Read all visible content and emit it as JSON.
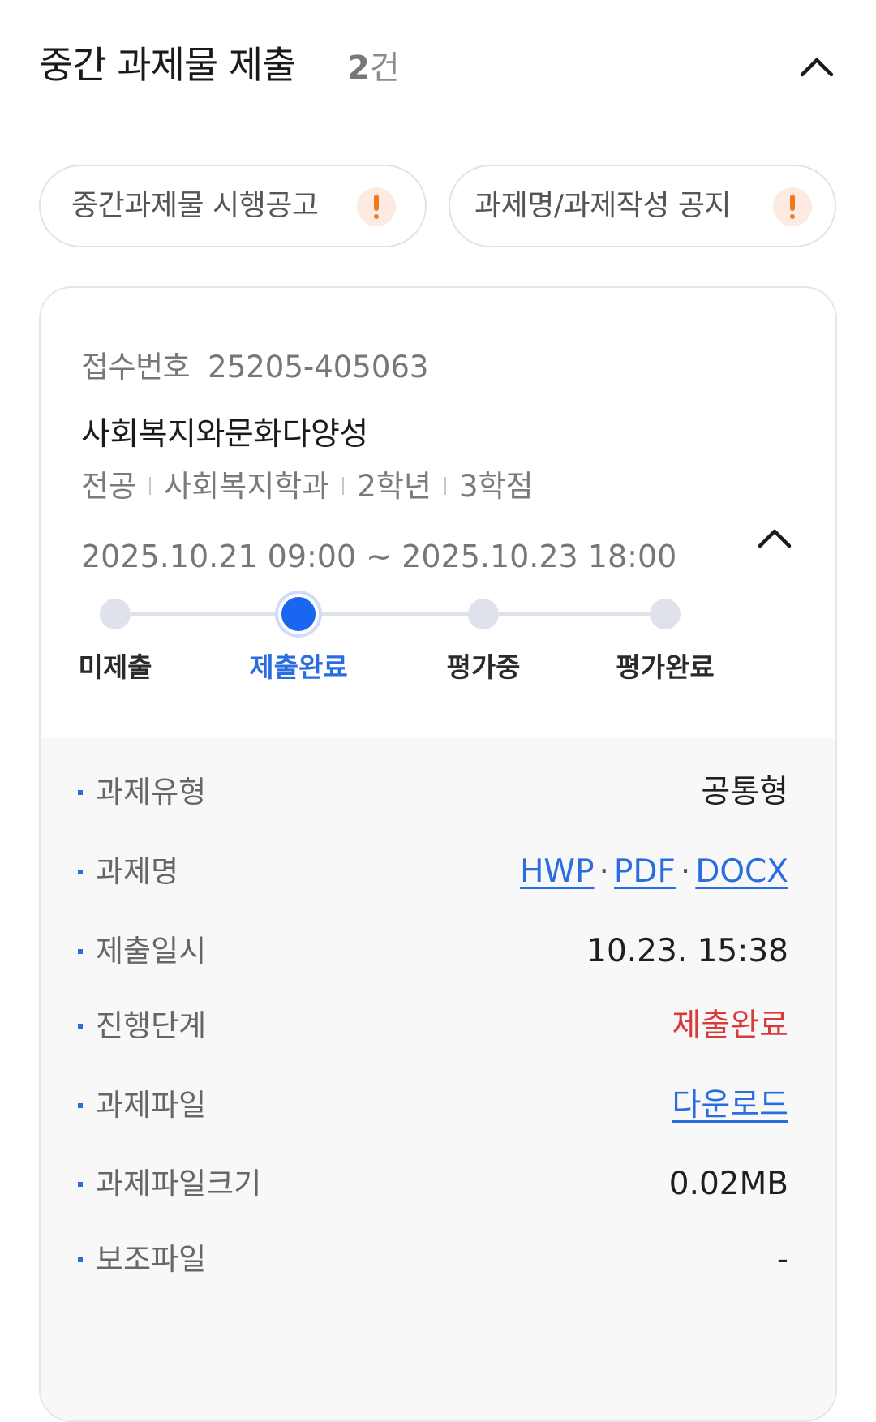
{
  "header": {
    "title": "중간 과제물 제출",
    "count_num": "2",
    "count_unit": "건",
    "collapse_icon": "chevron-up-icon"
  },
  "notices": [
    {
      "label": "중간과제물 시행공고",
      "icon": "alert-icon"
    },
    {
      "label": "과제명/과제작성 공지",
      "icon": "alert-icon"
    }
  ],
  "card": {
    "receipt_label": "접수번호",
    "receipt_number": "25205-405063",
    "course_title": "사회복지와문화다양성",
    "meta": [
      "전공",
      "사회복지학과",
      "2학년",
      "3학점"
    ],
    "period": "2025.10.21 09:00 ~ 2025.10.23 18:00",
    "steps": [
      {
        "label": "미제출",
        "active": false
      },
      {
        "label": "제출완료",
        "active": true
      },
      {
        "label": "평가중",
        "active": false
      },
      {
        "label": "평가완료",
        "active": false
      }
    ],
    "details": {
      "type": {
        "label": "과제유형",
        "value": "공통형"
      },
      "name": {
        "label": "과제명",
        "formats": [
          "HWP",
          "PDF",
          "DOCX"
        ],
        "separator": "·"
      },
      "submitted_at": {
        "label": "제출일시",
        "value": "10.23. 15:38"
      },
      "stage": {
        "label": "진행단계",
        "value": "제출완료"
      },
      "file": {
        "label": "과제파일",
        "value": "다운로드"
      },
      "file_size": {
        "label": "과제파일크기",
        "value": "0.02MB"
      },
      "sub_file": {
        "label": "보조파일",
        "value": "-"
      }
    }
  },
  "colors": {
    "accent_blue": "#2a6de0",
    "active_dot": "#1a66f0",
    "status_red": "#d93a3a",
    "alert_orange": "#f07b1a"
  }
}
